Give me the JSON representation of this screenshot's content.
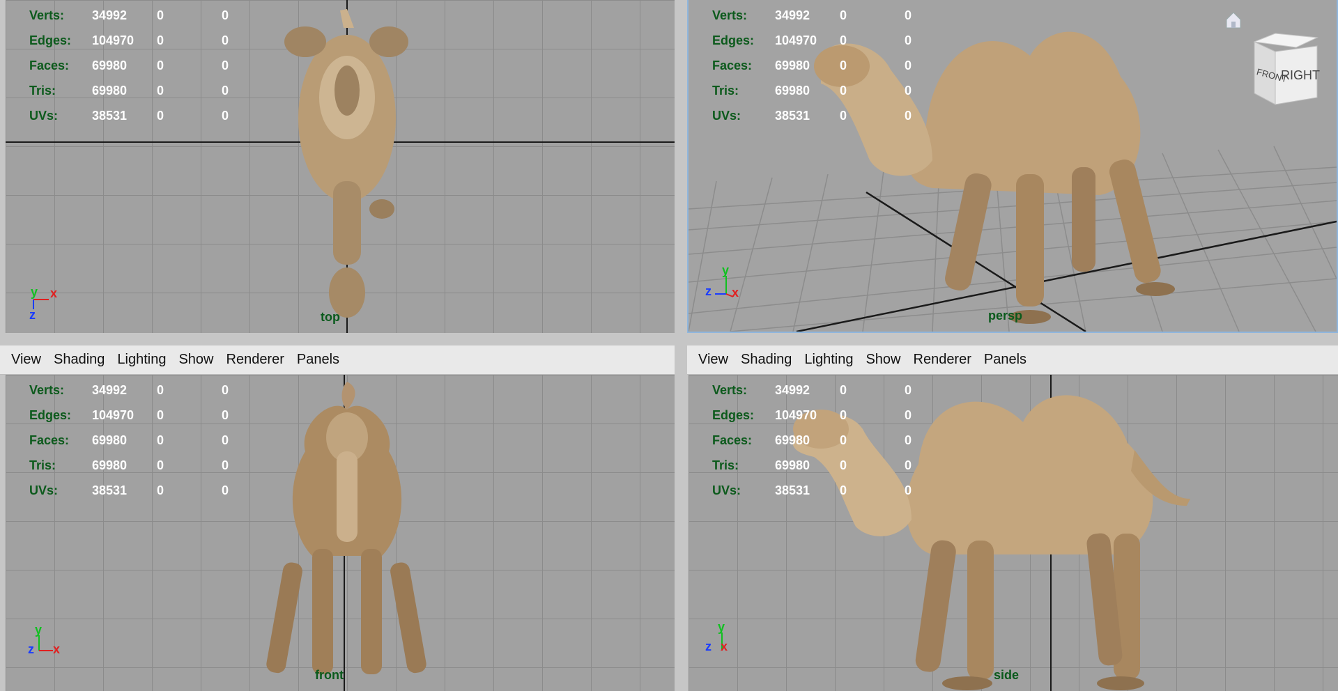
{
  "menu": [
    "View",
    "Shading",
    "Lighting",
    "Show",
    "Renderer",
    "Panels"
  ],
  "stats": [
    {
      "label": "Verts:",
      "values": [
        "34992",
        "0",
        "0"
      ]
    },
    {
      "label": "Edges:",
      "values": [
        "104970",
        "0",
        "0"
      ]
    },
    {
      "label": "Faces:",
      "values": [
        "69980",
        "0",
        "0"
      ]
    },
    {
      "label": "Tris:",
      "values": [
        "69980",
        "0",
        "0"
      ]
    },
    {
      "label": "UVs:",
      "values": [
        "38531",
        "0",
        "0"
      ]
    }
  ],
  "views": {
    "top": "top",
    "persp": "persp",
    "front": "front",
    "side": "side"
  },
  "axes": {
    "top": [
      "y",
      "x",
      "z"
    ],
    "persp": [
      "y",
      "z",
      "x"
    ],
    "front": [
      "y",
      "z",
      "x"
    ],
    "side": [
      "y",
      "z",
      "x"
    ]
  },
  "view_cube": {
    "front": "FRONT",
    "right": "RIGHT"
  },
  "colors": {
    "viewport_bg": "#a1a1a1",
    "grid_line": "#8b8b8b",
    "hud_label": "#0c5a1c",
    "axis_x": "#e02020",
    "axis_y": "#10c020",
    "axis_z": "#1a3cff",
    "active_border": "#8fb6dd"
  }
}
